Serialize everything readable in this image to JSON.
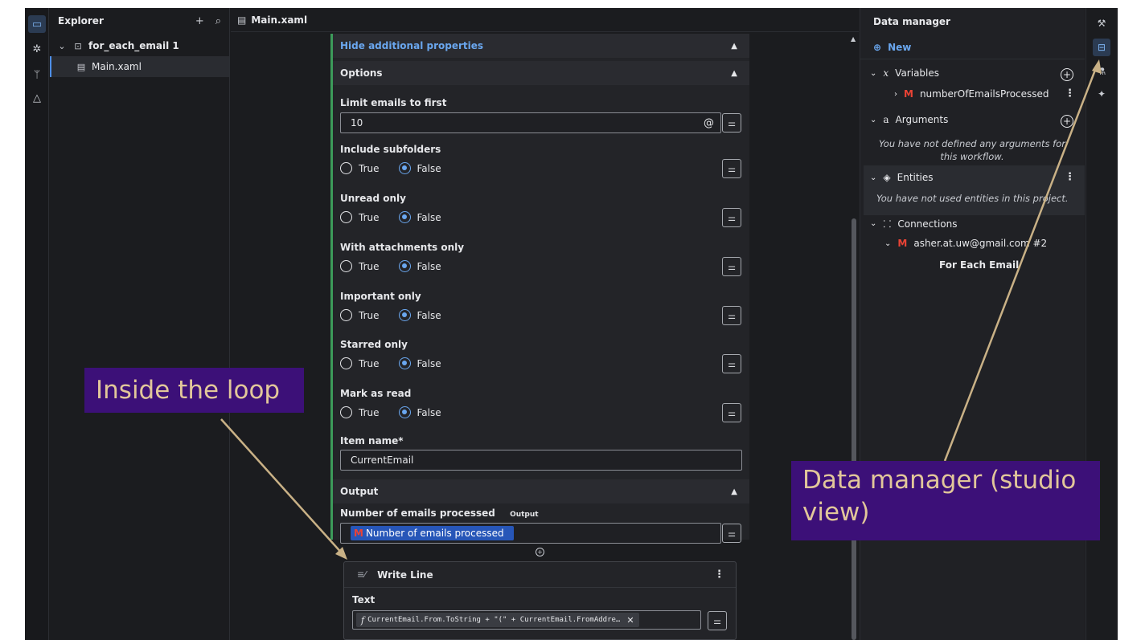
{
  "explorer": {
    "title": "Explorer",
    "project": "for_each_email 1",
    "file": "Main.xaml"
  },
  "editor": {
    "tab": "Main.xaml"
  },
  "properties": {
    "hide_additional": "Hide additional properties",
    "options_title": "Options",
    "limit_label": "Limit emails to first",
    "limit_value": "10",
    "radio_groups": [
      {
        "label": "Include subfolders",
        "selected": "False"
      },
      {
        "label": "Unread only",
        "selected": "False"
      },
      {
        "label": "With attachments only",
        "selected": "False"
      },
      {
        "label": "Important only",
        "selected": "False"
      },
      {
        "label": "Starred only",
        "selected": "False"
      },
      {
        "label": "Mark as read",
        "selected": "False"
      }
    ],
    "true_label": "True",
    "false_label": "False",
    "item_name_label": "Item name*",
    "item_name_value": "CurrentEmail",
    "output_title": "Output",
    "output_label": "Number of emails processed",
    "output_badge": "Output",
    "output_chip": "Number of emails processed"
  },
  "write_line": {
    "title": "Write Line",
    "text_label": "Text",
    "expression": "CurrentEmail.From.ToString + \"(\" + CurrentEmail.FromAddre…"
  },
  "data_manager": {
    "title": "Data manager",
    "new_label": "New",
    "variables_label": "Variables",
    "variable_name": "numberOfEmailsProcessed",
    "arguments_label": "Arguments",
    "arguments_note": "You have not defined any arguments for this workflow.",
    "entities_label": "Entities",
    "entities_note": "You have not used entities in this project.",
    "connections_label": "Connections",
    "connection_account": "asher.at.uw@gmail.com #2",
    "connection_usage": "For Each Email"
  },
  "annotations": {
    "inside_loop": "Inside the loop",
    "data_manager_line1": "Data manager (studio",
    "data_manager_line2": "view)"
  },
  "colors": {
    "accent": "#6aa7ef",
    "callout_bg": "#3c1078",
    "callout_text": "#e2c79a",
    "arrow": "#c9b186"
  }
}
